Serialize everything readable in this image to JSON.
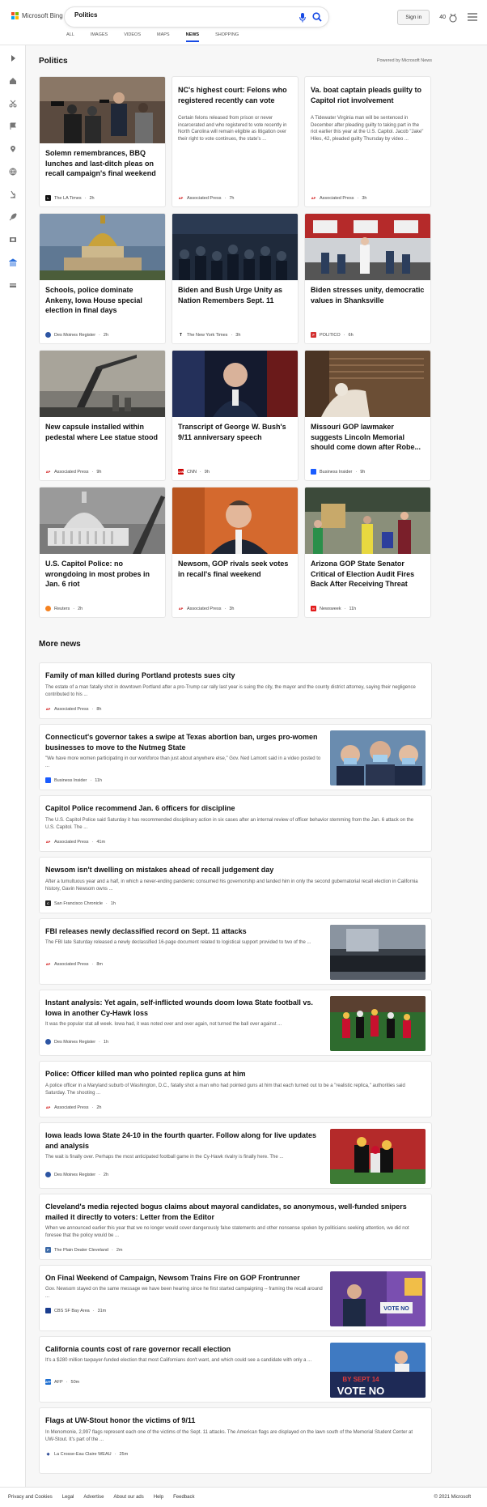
{
  "brand": {
    "name": "Microsoft Bing"
  },
  "search": {
    "query": "Politics"
  },
  "header": {
    "sign_in": "Sign in",
    "rewards_points": "40"
  },
  "tabs": [
    {
      "label": "ALL"
    },
    {
      "label": "IMAGES"
    },
    {
      "label": "VIDEOS"
    },
    {
      "label": "MAPS"
    },
    {
      "label": "NEWS",
      "active": true
    },
    {
      "label": "SHOPPING"
    }
  ],
  "section": {
    "title": "Politics",
    "powered_by": "Powered by Microsoft News"
  },
  "top_cards": [
    {
      "title": "Solemn remembrances, BBQ lunches and last-ditch pleas on recall campaign's final weekend",
      "source": "The LA Times",
      "age": "2h",
      "icon": "la-times-logo",
      "image": "press-conference-photo"
    },
    {
      "title": "NC's highest court: Felons who registered recently can vote",
      "snippet": "Certain felons released from prison or never incarcerated and who registered to vote recently in North Carolina will remain eligible as litigation over their right to vote continues, the state's ...",
      "source": "Associated Press",
      "age": "7h",
      "icon": "ap-logo"
    },
    {
      "title": "Va. boat captain pleads guilty to Capitol riot involvement",
      "snippet": "A Tidewater Virginia man will be sentenced in December after pleading guilty to taking part in the riot earlier this year at the U.S. Capitol. Jacob \"Jake\" Hiles, 42, pleaded guilty Thursday by video ...",
      "source": "Associated Press",
      "age": "3h",
      "icon": "ap-logo"
    },
    {
      "title": "Schools, police dominate Ankeny, Iowa House special election in final days",
      "source": "Des Moines Register",
      "age": "2h",
      "icon": "des-moines-register-logo",
      "image": "capitol-dome-photo"
    },
    {
      "title": "Biden and Bush Urge Unity as Nation Remembers Sept. 11",
      "source": "The New York Times",
      "age": "3h",
      "icon": "nyt-logo",
      "image": "crowd-ceremony-photo"
    },
    {
      "title": "Biden stresses unity, democratic values in Shanksville",
      "source": "POLITICO",
      "age": "6h",
      "icon": "politico-logo",
      "image": "firehouse-photo"
    },
    {
      "title": "New capsule installed within pedestal where Lee statue stood",
      "source": "Associated Press",
      "age": "9h",
      "icon": "ap-logo",
      "image": "crane-photo"
    },
    {
      "title": "Transcript of George W. Bush's 9/11 anniversary speech",
      "source": "CNN",
      "age": "9h",
      "icon": "cnn-logo",
      "image": "speaker-photo"
    },
    {
      "title": "Missouri GOP lawmaker suggests Lincoln Memorial should come down after Robe...",
      "source": "Business Insider",
      "age": "9h",
      "icon": "business-insider-logo",
      "image": "lincoln-memorial-photo"
    },
    {
      "title": "U.S. Capitol Police: no wrongdoing in most probes in Jan. 6 riot",
      "source": "Reuters",
      "age": "2h",
      "icon": "reuters-logo",
      "image": "capitol-building-photo"
    },
    {
      "title": "Newsom, GOP rivals seek votes in recall's final weekend",
      "source": "Associated Press",
      "age": "3h",
      "icon": "ap-logo",
      "image": "newsom-photo"
    },
    {
      "title": "Arizona GOP State Senator Critical of Election Audit Fires Back After Receiving Threat",
      "source": "Newsweek",
      "age": "11h",
      "icon": "newsweek-logo",
      "image": "audit-workers-photo"
    }
  ],
  "more_news": {
    "title": "More news",
    "items": [
      {
        "title": "Family of man killed during Portland protests sues city",
        "snippet": "The estate of a man fatally shot in downtown Portland after a pro-Trump car rally last year is suing the city, the mayor and the county district attorney, saying their negligence contributed to his ...",
        "source": "Associated Press",
        "age": "8h",
        "icon": "ap-logo"
      },
      {
        "title": "Connecticut's governor takes a swipe at Texas abortion ban, urges pro-women businesses to move to the Nutmeg State",
        "snippet": "\"We have more women participating in our workforce than just about anywhere else,\" Gov. Ned Lamont said in a video posted to ...",
        "source": "Business Insider",
        "age": "11h",
        "icon": "business-insider-logo",
        "image": "masked-officials-photo"
      },
      {
        "title": "Capitol Police recommend Jan. 6 officers for discipline",
        "snippet": "The U.S. Capitol Police said Saturday it has recommended disciplinary action in six cases after an internal review of officer behavior stemming from the Jan. 6 attack on the U.S. Capitol. The ...",
        "source": "Associated Press",
        "age": "41m",
        "icon": "ap-logo"
      },
      {
        "title": "Newsom isn't dwelling on mistakes ahead of recall judgement day",
        "snippet": "After a tumultuous year and a half, in which a never-ending pandemic consumed his governorship and landed him in only the second gubernatorial recall election in California history, Gavin Newsom owns ...",
        "source": "San Francisco Chronicle",
        "age": "1h",
        "icon": "sf-chronicle-logo"
      },
      {
        "title": "FBI releases newly declassified record on Sept. 11 attacks",
        "snippet": "The FBI late Saturday released a newly declassified 16-page document related to logistical support provided to two of the ...",
        "source": "Associated Press",
        "age": "8m",
        "icon": "ap-logo",
        "image": "memorial-pool-photo"
      },
      {
        "title": "Instant analysis: Yet again, self-inflicted wounds doom Iowa State football vs. Iowa in another Cy-Hawk loss",
        "snippet": "It was the popular stat all week. Iowa had, it was noted over and over again, not turned the ball over against ...",
        "source": "Des Moines Register",
        "age": "1h",
        "icon": "des-moines-register-logo",
        "image": "football-game-photo"
      },
      {
        "title": "Police: Officer killed man who pointed replica guns at him",
        "snippet": "A police officer in a Maryland suburb of Washington, D.C., fatally shot a man who had pointed guns at him that each turned out to be a \"realistic replica,\" authorities said Saturday. The shooting ...",
        "source": "Associated Press",
        "age": "2h",
        "icon": "ap-logo"
      },
      {
        "title": "Iowa leads Iowa State 24-10 in the fourth quarter. Follow along for live updates and analysis",
        "snippet": "The wait is finally over. Perhaps the most anticipated football game in the Cy-Hawk rivalry is finally here. The ...",
        "source": "Des Moines Register",
        "age": "2h",
        "icon": "des-moines-register-logo",
        "image": "football-tackle-photo"
      },
      {
        "title": "Cleveland's media rejected bogus claims about mayoral candidates, so anonymous, well-funded snipers mailed it directly to voters: Letter from the Editor",
        "snippet": "When we announced earlier this year that we no longer would cover dangerously false statements and other nonsense spoken by politicians seeking attention, we did not foresee that the policy would be ...",
        "source": "The Plain Dealer Cleveland",
        "age": "2m",
        "icon": "plain-dealer-logo"
      },
      {
        "title": "On Final Weekend of Campaign, Newsom Trains Fire on GOP Frontrunner",
        "snippet": "Gov. Newsom stayed on the same message we have been hearing since he first started campaigning -- framing the recall around ...",
        "source": "CBS SF Bay Area",
        "age": "31m",
        "icon": "cbs-logo",
        "image": "vote-no-rally-photo"
      },
      {
        "title": "California counts cost of rare governor recall election",
        "snippet": "It's a $280 million taxpayer-funded election that most Californians don't want, and which could see a candidate with only a ...",
        "source": "AFP",
        "age": "50m",
        "icon": "afp-logo",
        "image": "vote-no-sign-photo"
      },
      {
        "title": "Flags at UW-Stout honor the victims of 9/11",
        "snippet": "In Menomonie, 2,997 flags represent each one of the victims of the Sept. 11 attacks. The American flags are displayed on the lawn south of the Memorial Student Center at UW-Stout. It's part of the ...",
        "source": "La Crosse-Eau Claire WEAU",
        "age": "25m",
        "icon": "weau-logo"
      }
    ]
  },
  "image_text": {
    "vote_no": "VOTE NO",
    "by_sept_14": "BY SEPT 14",
    "vote_no_big": "VOTE NO"
  },
  "footer": {
    "links": [
      "Privacy and Cookies",
      "Legal",
      "Advertise",
      "About our ads",
      "Help",
      "Feedback"
    ],
    "copyright": "© 2021 Microsoft"
  }
}
